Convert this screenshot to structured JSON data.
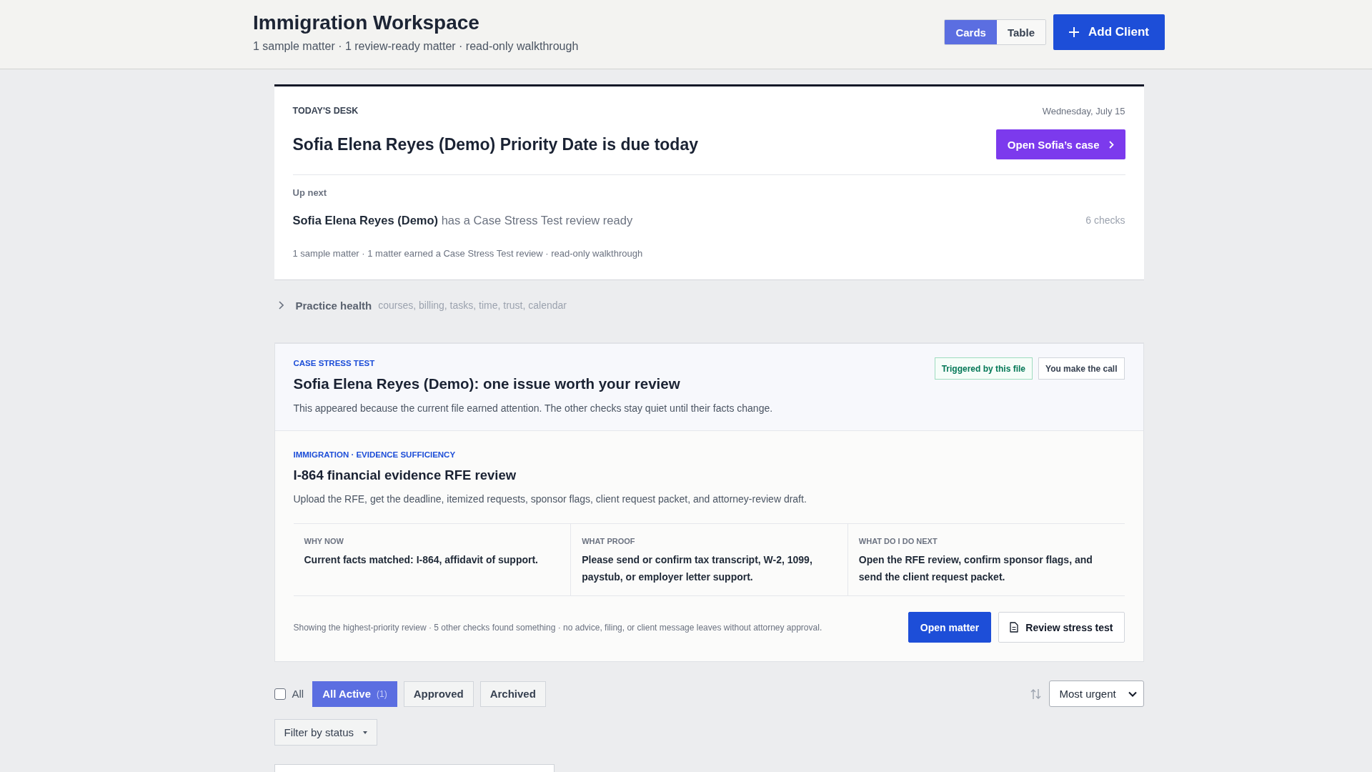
{
  "header": {
    "title": "Immigration Workspace",
    "subtitle": "1 sample matter · 1 review-ready matter · read-only walkthrough",
    "view_toggle": [
      {
        "label": "Cards",
        "selected": true
      },
      {
        "label": "Table",
        "selected": false
      }
    ],
    "add_button": {
      "label": "Add Client"
    }
  },
  "todays_desk": {
    "label": "TODAY'S DESK",
    "date": "Wednesday, July 15",
    "headline": "Sofia Elena Reyes (Demo) Priority Date is due today",
    "action": {
      "label": "Open Sofia’s case"
    },
    "up_next": {
      "label": "Up next",
      "text": "**Sofia Elena Reyes (Demo)** has a Case Stress Test review ready",
      "count": "6 checks"
    },
    "summary": "1 sample matter · 1 matter earned a Case Stress Test review · read-only walkthrough"
  },
  "practice_health": {
    "title": "Practice health",
    "topics": "courses, billing, tasks, time, trust, calendar",
    "expanded": false
  },
  "stress_test": {
    "label": "CASE STRESS TEST",
    "title": "Sofia Elena Reyes (Demo): one issue worth your review",
    "description": "This appeared because the current file earned attention. The other checks stay quiet until their facts change.",
    "badges": [
      {
        "label": "Triggered by this file",
        "kind": "success"
      },
      {
        "label": "You make the call",
        "kind": "neutral"
      }
    ],
    "issue": {
      "category": "IMMIGRATION · EVIDENCE SUFFICIENCY",
      "title": "I-864 financial evidence RFE review",
      "description": "Upload the RFE, get the deadline, itemized requests, sponsor flags, client request packet, and attorney-review draft.",
      "facts": [
        {
          "label": "WHY NOW",
          "text": "Current facts matched: I-864, affidavit of support."
        },
        {
          "label": "WHAT PROOF",
          "text": "Please send or confirm tax transcript, W-2, 1099, paystub, or employer letter support."
        },
        {
          "label": "WHAT DO I DO NEXT",
          "text": "Open the RFE review, confirm sponsor flags, and send the client request packet."
        }
      ],
      "note": "Showing the highest-priority review · 5 other checks found something · no advice, filing, or client message leaves without attorney approval.",
      "actions": [
        {
          "label": "Open matter",
          "kind": "primary"
        },
        {
          "label": "Review stress test",
          "kind": "secondary"
        }
      ]
    }
  },
  "filters": {
    "select_all": {
      "label": "All",
      "checked": false
    },
    "tabs": [
      {
        "label": "All Active",
        "count": "(1)",
        "selected": true
      },
      {
        "label": "Approved",
        "selected": false
      },
      {
        "label": "Archived",
        "selected": false
      }
    ],
    "sort": {
      "value": "Most urgent"
    },
    "status_filter": {
      "label": "Filter by status"
    }
  }
}
